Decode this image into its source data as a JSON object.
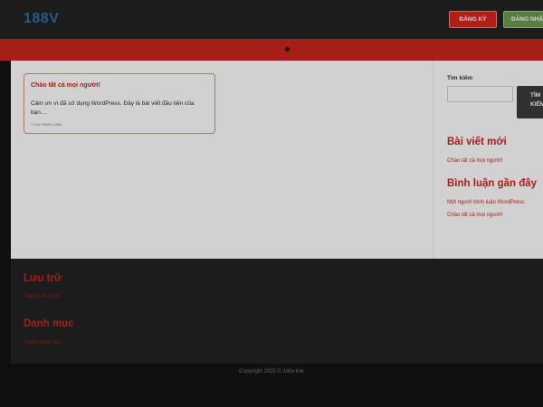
{
  "header": {
    "logo": "188V",
    "register_label": "ĐĂNG KÝ",
    "login_label": "ĐĂNG NHẬP"
  },
  "navbar": {
    "toggle_icon": "dot-menu-icon"
  },
  "post": {
    "title": "Chào tất cả mọi người!",
    "excerpt": "Cảm ơn vì đã sử dụng WordPress. Đây là bài viết đầu tiên của bạn…",
    "comments": "1 Các bình luận"
  },
  "sidebar": {
    "search_label": "Tìm kiếm",
    "search_placeholder": "",
    "search_button_line1": "TÌM",
    "search_button_line2": "KIẾM",
    "recent_posts_title": "Bài viết mới",
    "recent_posts": [
      "Chào tất cả mọi người!"
    ],
    "recent_comments_title": "Bình luận gần đây",
    "recent_comment_author": "Một người bình luận WordPress",
    "recent_comment_post": "Chào tất cả mọi người!"
  },
  "footer": {
    "archives_title": "Lưu trữ",
    "archive_item": "Tháng 10 2025",
    "categories_title": "Danh mục",
    "category_item": "Chưa phân loại"
  },
  "copyright": "Copyright 2025 © 188v.link",
  "colors": {
    "brand_red": "#c9271d",
    "logo_blue": "#2f6fa6",
    "header_dark": "#232323",
    "login_green": "#6f9a4f"
  }
}
